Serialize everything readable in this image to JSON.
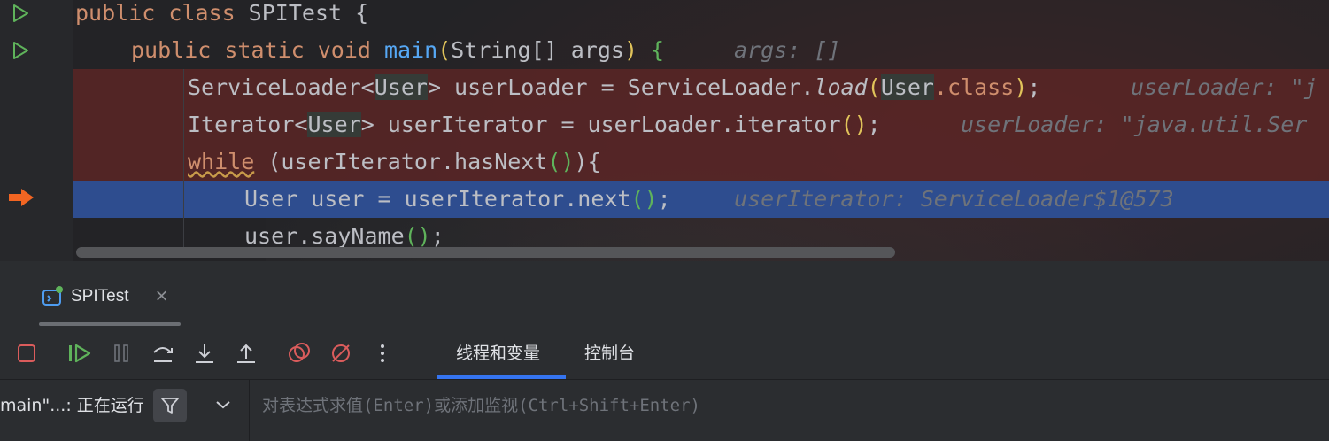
{
  "editor": {
    "lines": [
      {
        "kw1": "public class ",
        "name": "SPITest",
        "tail": " {"
      },
      {
        "kw1": "public static void ",
        "fn": "main",
        "p1": "(",
        "params": "String[] args",
        "p2": ")",
        "brace": " {",
        "hint": "args: []"
      },
      {
        "t1": "ServiceLoader<",
        "user1": "User",
        "t2": "> userLoader = ServiceLoader.",
        "load": "load",
        "p1": "(",
        "user2": "User",
        "cls": ".class",
        "p2": ")",
        "semi": ";",
        "hint": "userLoader: \"j"
      },
      {
        "t1": "Iterator<",
        "user1": "User",
        "t2": "> userIterator = userLoader.iterator",
        "p": "()",
        "semi": ";",
        "hint": "userLoader: \"java.util.Ser"
      },
      {
        "kw": "while",
        "t1": " (userIterator.hasNext",
        "p1": "()",
        "t2": "){"
      },
      {
        "t1": "User user = userIterator.next",
        "p": "()",
        "semi": ";",
        "hint": "userIterator: ServiceLoader$1@573"
      },
      {
        "t1": "user.sayName",
        "p": "()",
        "semi": ";"
      }
    ]
  },
  "debug_tab": {
    "label": "SPITest",
    "icon": "debug-window-icon",
    "close": "×"
  },
  "toolbar": {
    "icons": [
      "stop-icon",
      "resume-icon",
      "pause-icon",
      "step-over-icon",
      "step-into-icon",
      "step-out-icon",
      "breakpoints-icon",
      "mute-breakpoints-icon",
      "more-icon"
    ],
    "tabs": [
      "线程和变量",
      "控制台"
    ],
    "active_tab": "线程和变量"
  },
  "bottom": {
    "thread": "main\"...: 正在运行",
    "eval_placeholder": "对表达式求值(Enter)或添加监视(Ctrl+Shift+Enter)"
  },
  "colors": {
    "keyword": "#cf8e6d",
    "function": "#56a8f5",
    "breakpoint_line": "#5a2626",
    "exec_line": "#2e4d8f",
    "accent": "#3574f0"
  }
}
